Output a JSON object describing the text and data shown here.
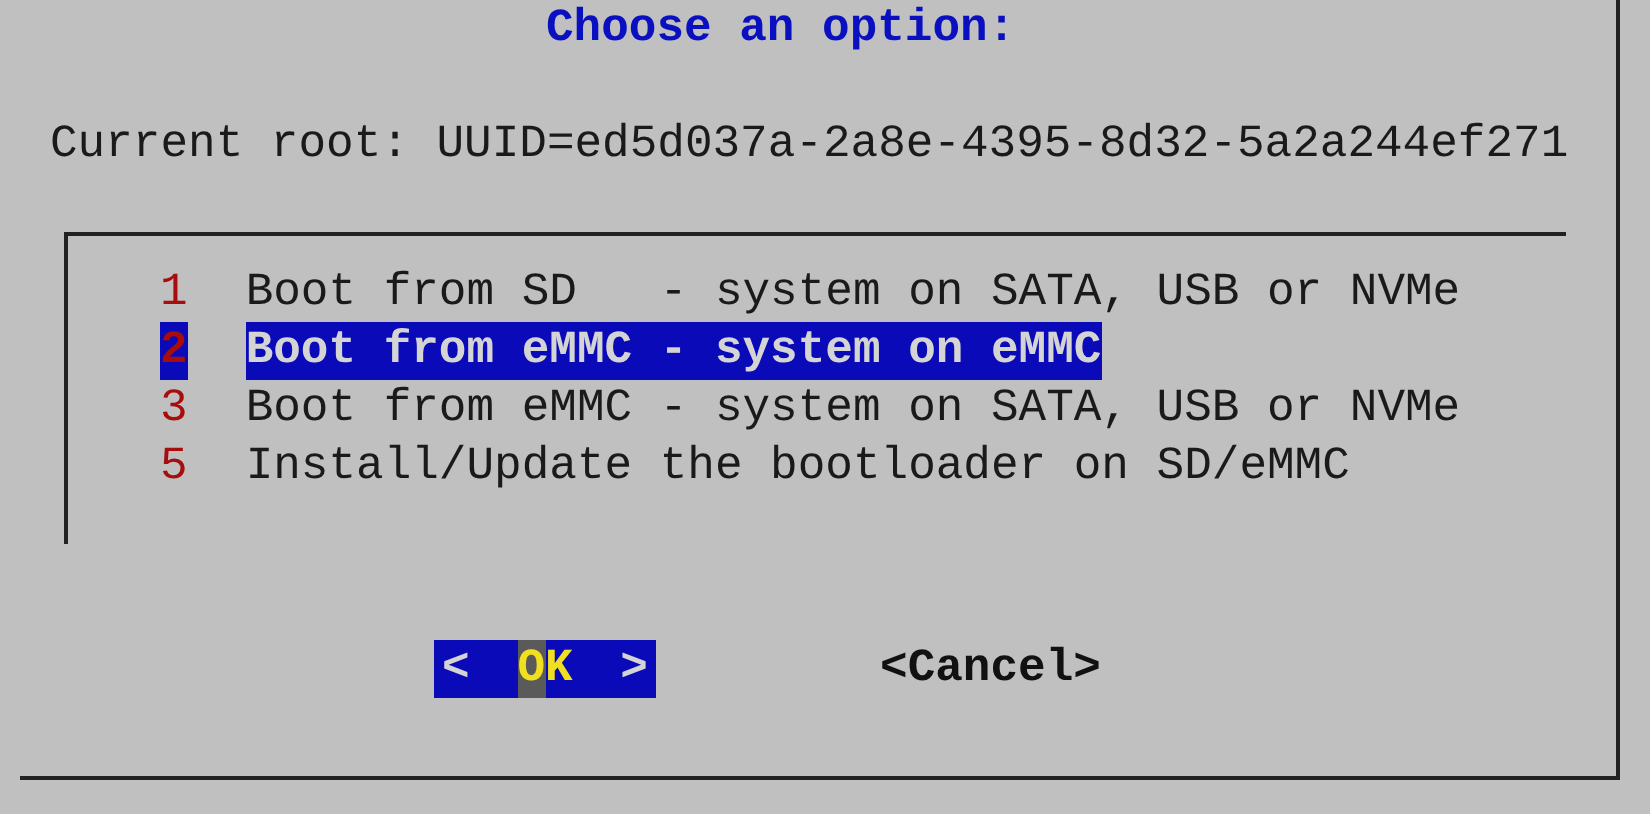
{
  "dialog": {
    "title": "Choose an option:",
    "message": "Current root: UUID=ed5d037a-2a8e-4395-8d32-5a2a244ef271",
    "items": [
      {
        "tag": "1",
        "label": "Boot from SD   - system on SATA, USB or NVMe",
        "selected": false
      },
      {
        "tag": "2",
        "label": "Boot from eMMC - system on eMMC",
        "selected": true
      },
      {
        "tag": "3",
        "label": "Boot from eMMC - system on SATA, USB or NVMe",
        "selected": false
      },
      {
        "tag": "5",
        "label": "Install/Update the bootloader on SD/eMMC",
        "selected": false
      }
    ],
    "buttons": [
      {
        "open": "<",
        "label": "OK",
        "close": ">",
        "selected": true
      },
      {
        "open": "<",
        "label": "Cancel",
        "close": ">",
        "selected": false
      }
    ]
  }
}
